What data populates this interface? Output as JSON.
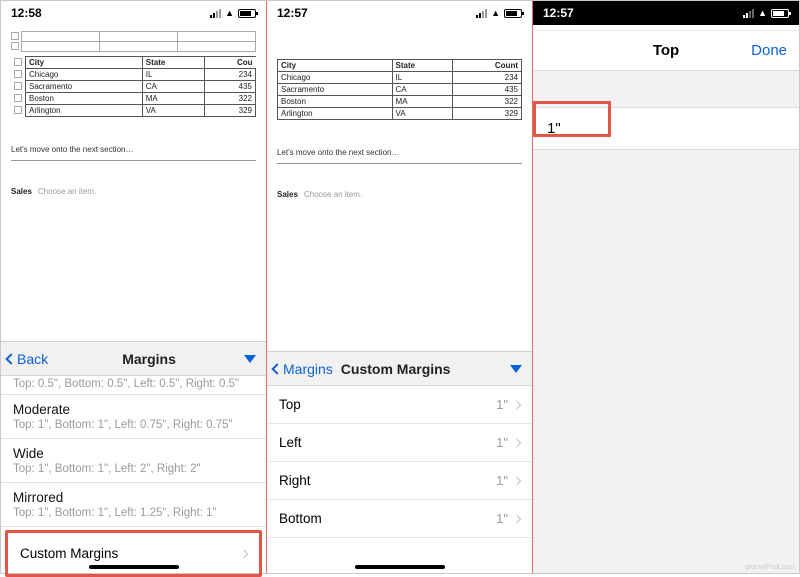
{
  "times": {
    "p1": "12:58",
    "p2": "12:57",
    "p3": "12:57"
  },
  "table": {
    "headers": [
      "City",
      "State",
      "Count"
    ],
    "rows": [
      [
        "Chicago",
        "IL",
        "234"
      ],
      [
        "Sacramento",
        "CA",
        "435"
      ],
      [
        "Boston",
        "MA",
        "322"
      ],
      [
        "Arlington",
        "VA",
        "329"
      ]
    ]
  },
  "body_text": "Let's move onto the next section…",
  "sales": {
    "label": "Sales",
    "hint": "Choose an item."
  },
  "panel1": {
    "back": "Back",
    "title": "Margins",
    "cutoff": "Top: 0.5\", Bottom: 0.5\", Left: 0.5\", Right: 0.5\"",
    "options": [
      {
        "name": "Moderate",
        "desc": "Top: 1\", Bottom: 1\", Left: 0.75\", Right: 0.75\""
      },
      {
        "name": "Wide",
        "desc": "Top: 1\", Bottom: 1\", Left: 2\", Right: 2\""
      },
      {
        "name": "Mirrored",
        "desc": "Top: 1\", Bottom: 1\", Left: 1.25\", Right: 1\""
      }
    ],
    "custom": "Custom Margins"
  },
  "panel2": {
    "back": "Margins",
    "title": "Custom Margins",
    "rows": [
      {
        "label": "Top",
        "value": "1\""
      },
      {
        "label": "Left",
        "value": "1\""
      },
      {
        "label": "Right",
        "value": "1\""
      },
      {
        "label": "Bottom",
        "value": "1\""
      }
    ]
  },
  "panel3": {
    "title": "Top",
    "done": "Done",
    "value": "1\""
  },
  "watermark": "groovyPost.com"
}
